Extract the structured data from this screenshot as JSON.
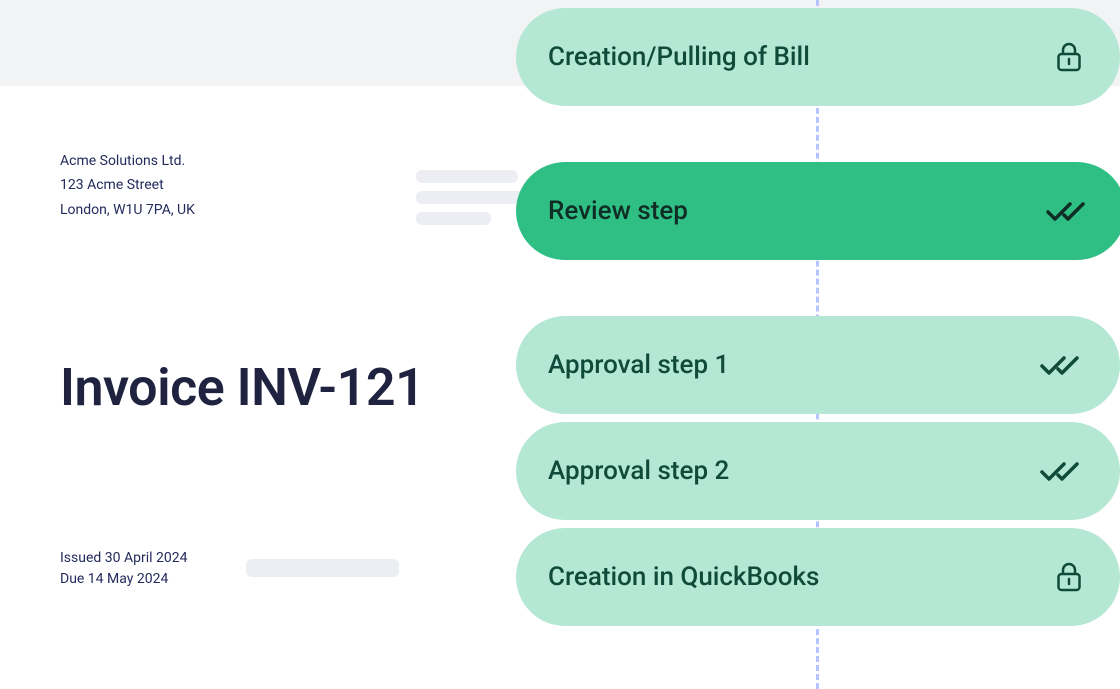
{
  "invoice": {
    "company_name": "Acme Solutions Ltd.",
    "company_street": "123 Acme Street",
    "company_city": "London, W1U 7PA, UK",
    "title": "Invoice INV-121",
    "issued_label": "Issued 30 April 2024",
    "due_label": "Due 14 May 2024"
  },
  "workflow": {
    "steps": [
      {
        "label": "Creation/Pulling of Bill",
        "icon": "lock"
      },
      {
        "label": "Review step",
        "icon": "double-check"
      },
      {
        "label": "Approval step 1",
        "icon": "double-check"
      },
      {
        "label": "Approval step 2",
        "icon": "double-check"
      },
      {
        "label": "Creation in QuickBooks",
        "icon": "lock"
      }
    ]
  }
}
